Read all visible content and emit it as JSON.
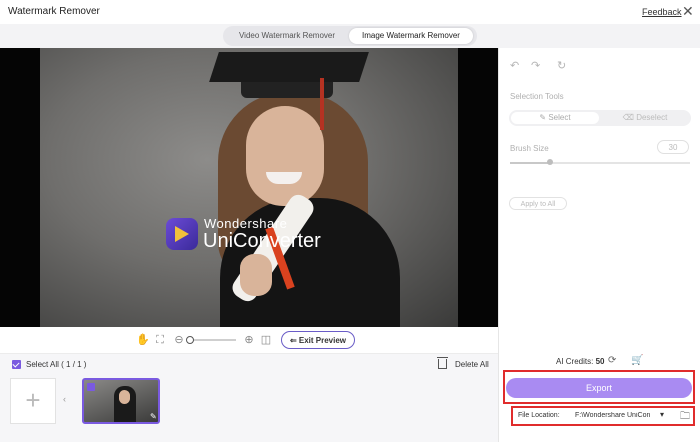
{
  "window": {
    "title": "Watermark Remover",
    "feedback": "Feedback",
    "close_icon": "close-icon"
  },
  "mode_tabs": [
    {
      "label": "Video Watermark Remover",
      "active": false
    },
    {
      "label": "Image Watermark Remover",
      "active": true
    }
  ],
  "preview": {
    "watermark_brand": "Wondershare",
    "watermark_product": "UniConverter",
    "exit_preview_label": "Exit Preview"
  },
  "file_list": {
    "select_all_label": "Select All ( 1 / 1 )",
    "delete_all_label": "Delete All",
    "add_label": "+"
  },
  "tools": {
    "section_label": "Selection Tools",
    "select_label": "Select",
    "deselect_label": "Deselect",
    "brush_label": "Brush Size",
    "brush_value": "30",
    "apply_label": "Apply to All"
  },
  "footer": {
    "credits_label": "AI Credits:",
    "credits_value": "50",
    "export_label": "Export",
    "file_location_label": "File Location:",
    "file_location_value": "F:\\Wondershare UniCon"
  },
  "colors": {
    "accent": "#7a5ae0",
    "export_bg": "#a98bf2",
    "highlight_border": "#e02c2c"
  }
}
